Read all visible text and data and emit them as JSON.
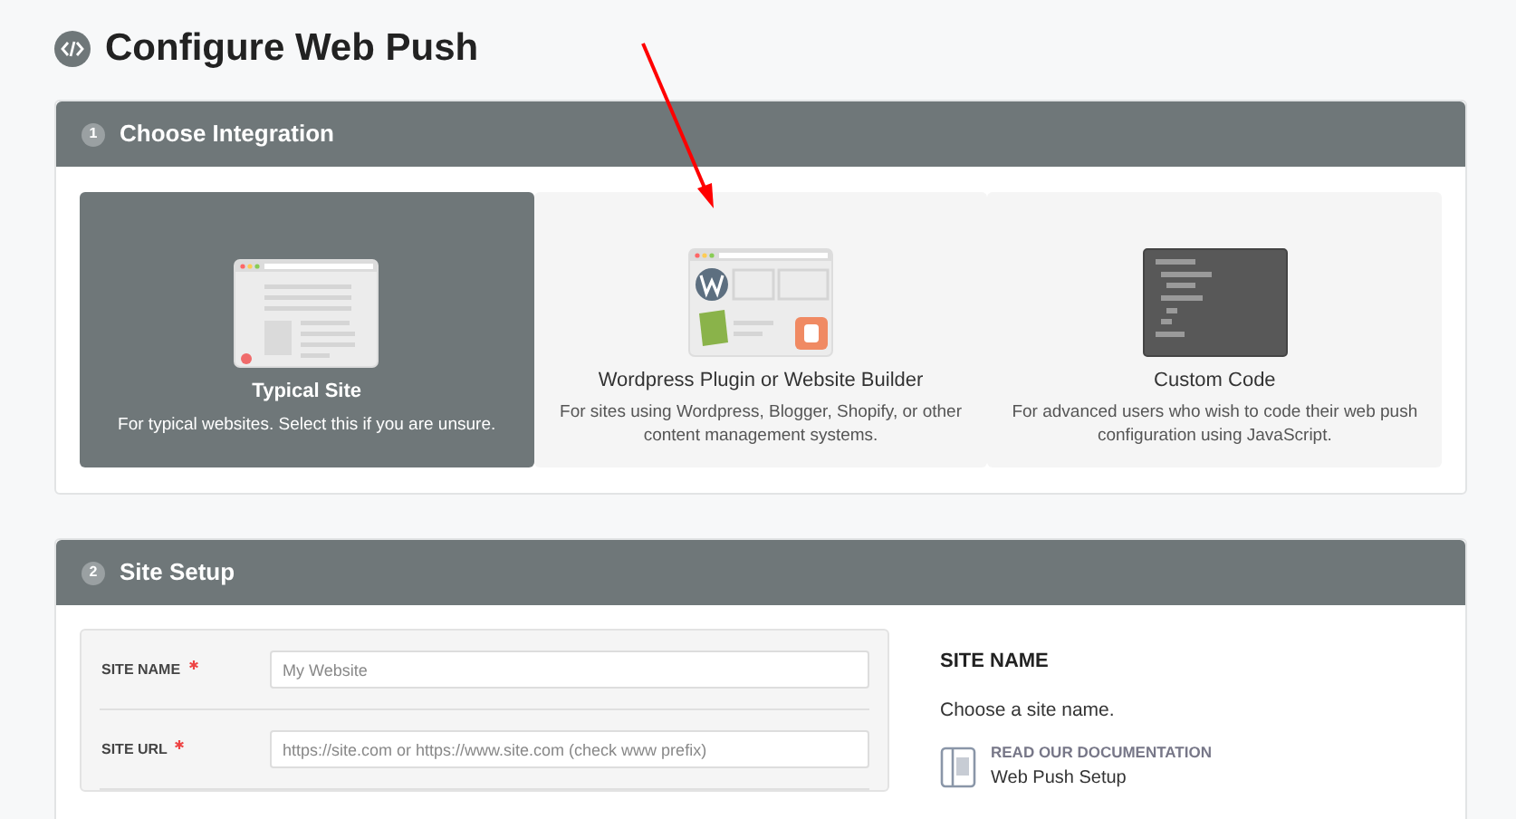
{
  "page": {
    "title": "Configure Web Push"
  },
  "integration": {
    "step": "1",
    "title": "Choose Integration",
    "options": [
      {
        "kind": "typical",
        "title": "Typical Site",
        "description": "For typical websites. Select this if you are unsure.",
        "selected": true
      },
      {
        "kind": "plugin",
        "title": "Wordpress Plugin or Website Builder",
        "description": "For sites using Wordpress, Blogger, Shopify, or other content management systems.",
        "selected": false
      },
      {
        "kind": "code",
        "title": "Custom Code",
        "description": "For advanced users who wish to code their web push configuration using JavaScript.",
        "selected": false
      }
    ]
  },
  "site_setup": {
    "step": "2",
    "title": "Site Setup",
    "fields": [
      {
        "label": "SITE NAME",
        "required": true,
        "placeholder": "My Website"
      },
      {
        "label": "SITE URL",
        "required": true,
        "placeholder": "https://site.com or https://www.site.com (check www prefix)"
      }
    ],
    "help": {
      "heading": "SITE NAME",
      "text": "Choose a site name.",
      "doc_label": "READ OUR DOCUMENTATION",
      "doc_link": "Web Push Setup"
    }
  }
}
